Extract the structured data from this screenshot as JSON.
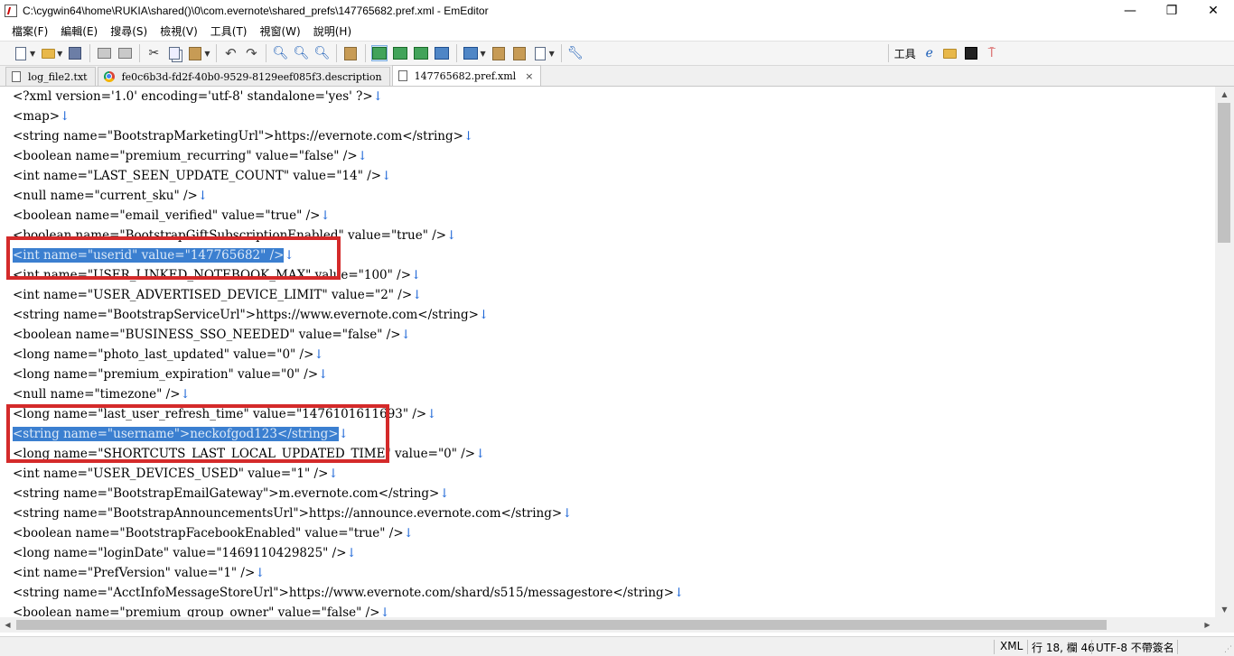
{
  "window": {
    "title": "C:\\cygwin64\\home\\RUKIA\\shared()\\0\\com.evernote\\shared_prefs\\147765682.pref.xml - EmEditor",
    "minimize": "—",
    "maximize": "❐",
    "close": "✕"
  },
  "menu": [
    "檔案(F)",
    "編輯(E)",
    "搜尋(S)",
    "檢視(V)",
    "工具(T)",
    "視窗(W)",
    "說明(H)"
  ],
  "toolbar": {
    "tools_label": "工具"
  },
  "tabs": [
    {
      "label": "log_file2.txt",
      "icon": "document-icon"
    },
    {
      "label": "fe0c6b3d-fd2f-40b0-9529-8129eef085f3.description",
      "icon": "chrome-icon"
    },
    {
      "label": "147765682.pref.xml",
      "icon": "document-icon",
      "active": true,
      "close": "×"
    }
  ],
  "editor": {
    "lines": [
      "<?xml version='1.0' encoding='utf-8' standalone='yes' ?>",
      "<map>",
      "<string name=\"BootstrapMarketingUrl\">https://evernote.com</string>",
      "<boolean name=\"premium_recurring\" value=\"false\" />",
      "<int name=\"LAST_SEEN_UPDATE_COUNT\" value=\"14\" />",
      "<null name=\"current_sku\" />",
      "<boolean name=\"email_verified\" value=\"true\" />",
      "<boolean name=\"BootstrapGiftSubscriptionEnabled\" value=\"true\" />",
      "<int name=\"userid\" value=\"147765682\" />",
      "<int name=\"USER_LINKED_NOTEBOOK_MAX\" value=\"100\" />",
      "<int name=\"USER_ADVERTISED_DEVICE_LIMIT\" value=\"2\" />",
      "<string name=\"BootstrapServiceUrl\">https://www.evernote.com</string>",
      "<boolean name=\"BUSINESS_SSO_NEEDED\" value=\"false\" />",
      "<long name=\"photo_last_updated\" value=\"0\" />",
      "<long name=\"premium_expiration\" value=\"0\" />",
      "<null name=\"timezone\" />",
      "<long name=\"last_user_refresh_time\" value=\"1476101611693\" />",
      "<string name=\"username\">neckofgod123</string>",
      "<long name=\"SHORTCUTS_LAST_LOCAL_UPDATED_TIME\" value=\"0\" />",
      "<int name=\"USER_DEVICES_USED\" value=\"1\" />",
      "<string name=\"BootstrapEmailGateway\">m.evernote.com</string>",
      "<string name=\"BootstrapAnnouncementsUrl\">https://announce.evernote.com</string>",
      "<boolean name=\"BootstrapFacebookEnabled\" value=\"true\" />",
      "<long name=\"loginDate\" value=\"1469110429825\" />",
      "<int name=\"PrefVersion\" value=\"1\" />",
      "<string name=\"AcctInfoMessageStoreUrl\">https://www.evernote.com/shard/s515/messagestore</string>",
      "<boolean name=\"premium_group_owner\" value=\"false\" />"
    ],
    "return_mark": "↓",
    "selected_lines": [
      8,
      17
    ]
  },
  "status": {
    "mode": "XML",
    "position": "行 18, 欄 46",
    "encoding": "UTF-8 不帶簽名"
  },
  "colors": {
    "selection": "#3b7fd0",
    "annotation_box": "#d42a2a",
    "return_mark": "#1a64d6"
  }
}
